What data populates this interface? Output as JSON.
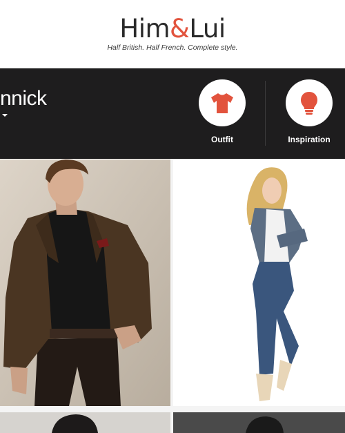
{
  "header": {
    "logo_left": "Him",
    "logo_amp": "&",
    "logo_right": "Lui",
    "tagline": "Half British. Half French. Complete style."
  },
  "profile": {
    "name": "nnick"
  },
  "categories": [
    {
      "label": "Outfit",
      "icon": "tshirt-icon"
    },
    {
      "label": "Inspiration",
      "icon": "lightbulb-icon"
    }
  ],
  "colors": {
    "accent": "#e2533d",
    "bar": "#1e1d1e",
    "background": "#f4f4f4"
  }
}
